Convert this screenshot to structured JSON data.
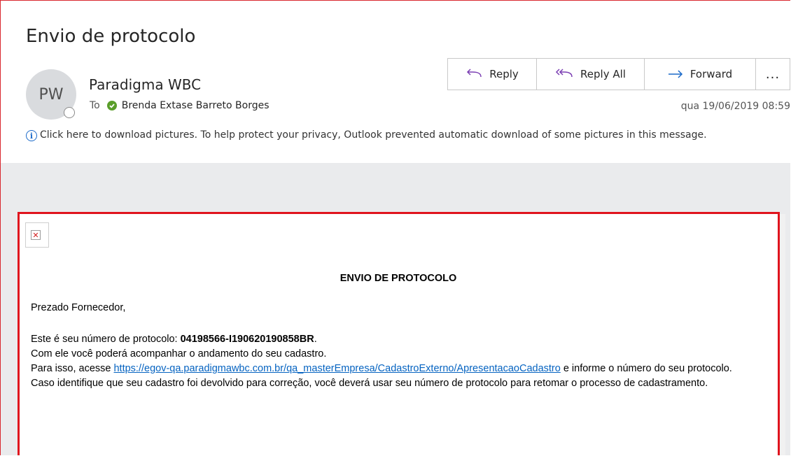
{
  "email": {
    "subject": "Envio de protocolo",
    "sender_initials": "PW",
    "sender_name": "Paradigma WBC",
    "to_label": "To",
    "recipient": "Brenda Extase Barreto Borges",
    "date": "qua 19/06/2019 08:59"
  },
  "actions": {
    "reply": "Reply",
    "reply_all": "Reply All",
    "forward": "Forward",
    "more": "..."
  },
  "info_bar": {
    "text": "Click here to download pictures. To help protect your privacy, Outlook prevented automatic download of some pictures in this message."
  },
  "body": {
    "heading": "ENVIO DE PROTOCOLO",
    "greeting": "Prezado Fornecedor,",
    "protocol_prefix": "Este é seu número de protocolo: ",
    "protocol_number": "04198566-I190620190858BR",
    "protocol_suffix": ".",
    "line2": "Com ele você poderá acompanhar o andamento do seu cadastro.",
    "line3_prefix": "Para isso, acesse ",
    "link": "https://egov-qa.paradigmawbc.com.br/qa_masterEmpresa/CadastroExterno/ApresentacaoCadastro",
    "line3_suffix": " e informe o número do seu protocolo.",
    "line4": "Caso identifique que seu cadastro foi devolvido para correção, você deverá usar seu número de protocolo para retomar o processo de cadastramento."
  },
  "colors": {
    "highlight_border": "#e0141e",
    "link": "#0563c1",
    "presence_green": "#5a9e2a",
    "info_blue": "#1b6ac9"
  }
}
